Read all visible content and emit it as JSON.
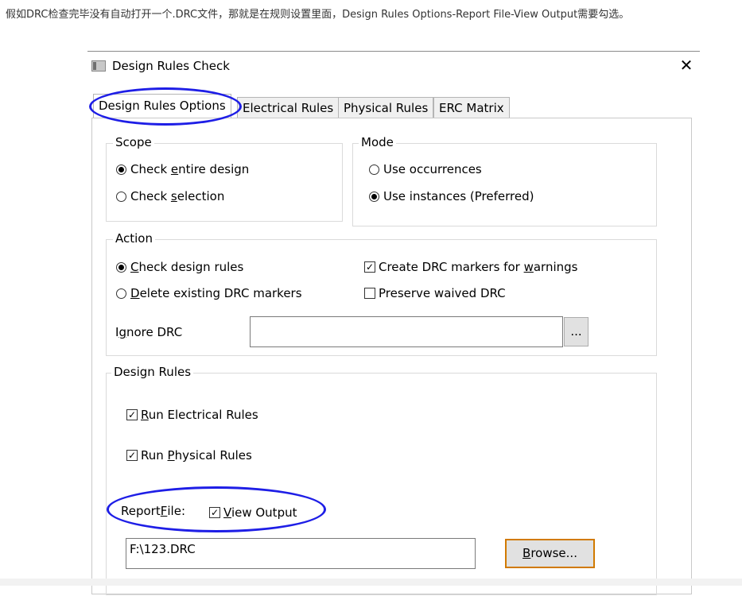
{
  "caption": "假如DRC检查完毕没有自动打开一个.DRC文件，那就是在规则设置里面，Design Rules Options-Report File-View Output需要勾选。",
  "window": {
    "title": "Design Rules Check",
    "close_glyph": "✕"
  },
  "tabs": [
    {
      "label": "Design Rules Options",
      "active": true
    },
    {
      "label": "Electrical Rules",
      "active": false
    },
    {
      "label": "Physical Rules",
      "active": false
    },
    {
      "label": "ERC Matrix",
      "active": false
    }
  ],
  "scope": {
    "label": "Scope",
    "check_entire": {
      "pre": "Check ",
      "u": "e",
      "post": "ntire design",
      "selected": true
    },
    "check_selection": {
      "pre": "Check ",
      "u": "s",
      "post": "election",
      "selected": false
    }
  },
  "mode": {
    "label": "Mode",
    "use_occurrences": {
      "label": "Use occurrences",
      "selected": false
    },
    "use_instances": {
      "label": "Use instances (Preferred)",
      "selected": true
    }
  },
  "action": {
    "label": "Action",
    "check_design_rules": {
      "u": "C",
      "post": "heck design rules",
      "selected": true
    },
    "delete_markers": {
      "u": "D",
      "post": "elete existing DRC markers",
      "selected": false
    },
    "create_markers": {
      "pre": "Create DRC markers for ",
      "u": "w",
      "post": "arnings",
      "checked": true
    },
    "preserve_waived": {
      "label": "Preserve waived DRC",
      "checked": false
    },
    "ignore_drc": {
      "pre": "I",
      "u": "g",
      "post": "nore DRC",
      "value": ""
    },
    "browse_small": "..."
  },
  "design_rules": {
    "label": "Design Rules",
    "run_electrical": {
      "u": "R",
      "post": "un Electrical Rules",
      "checked": true
    },
    "run_physical": {
      "pre": "Run ",
      "u": "P",
      "post": "hysical Rules",
      "checked": true
    },
    "report_file": {
      "pre": "Report ",
      "u": "F",
      "post": "ile:"
    },
    "view_output": {
      "u": "V",
      "post": "iew Output",
      "checked": true
    },
    "report_path": "F:\\123.DRC",
    "browse": {
      "u": "B",
      "post": "rowse..."
    }
  },
  "colors": {
    "highlight": "#1e1ee6",
    "focus_border": "#d17a00"
  }
}
